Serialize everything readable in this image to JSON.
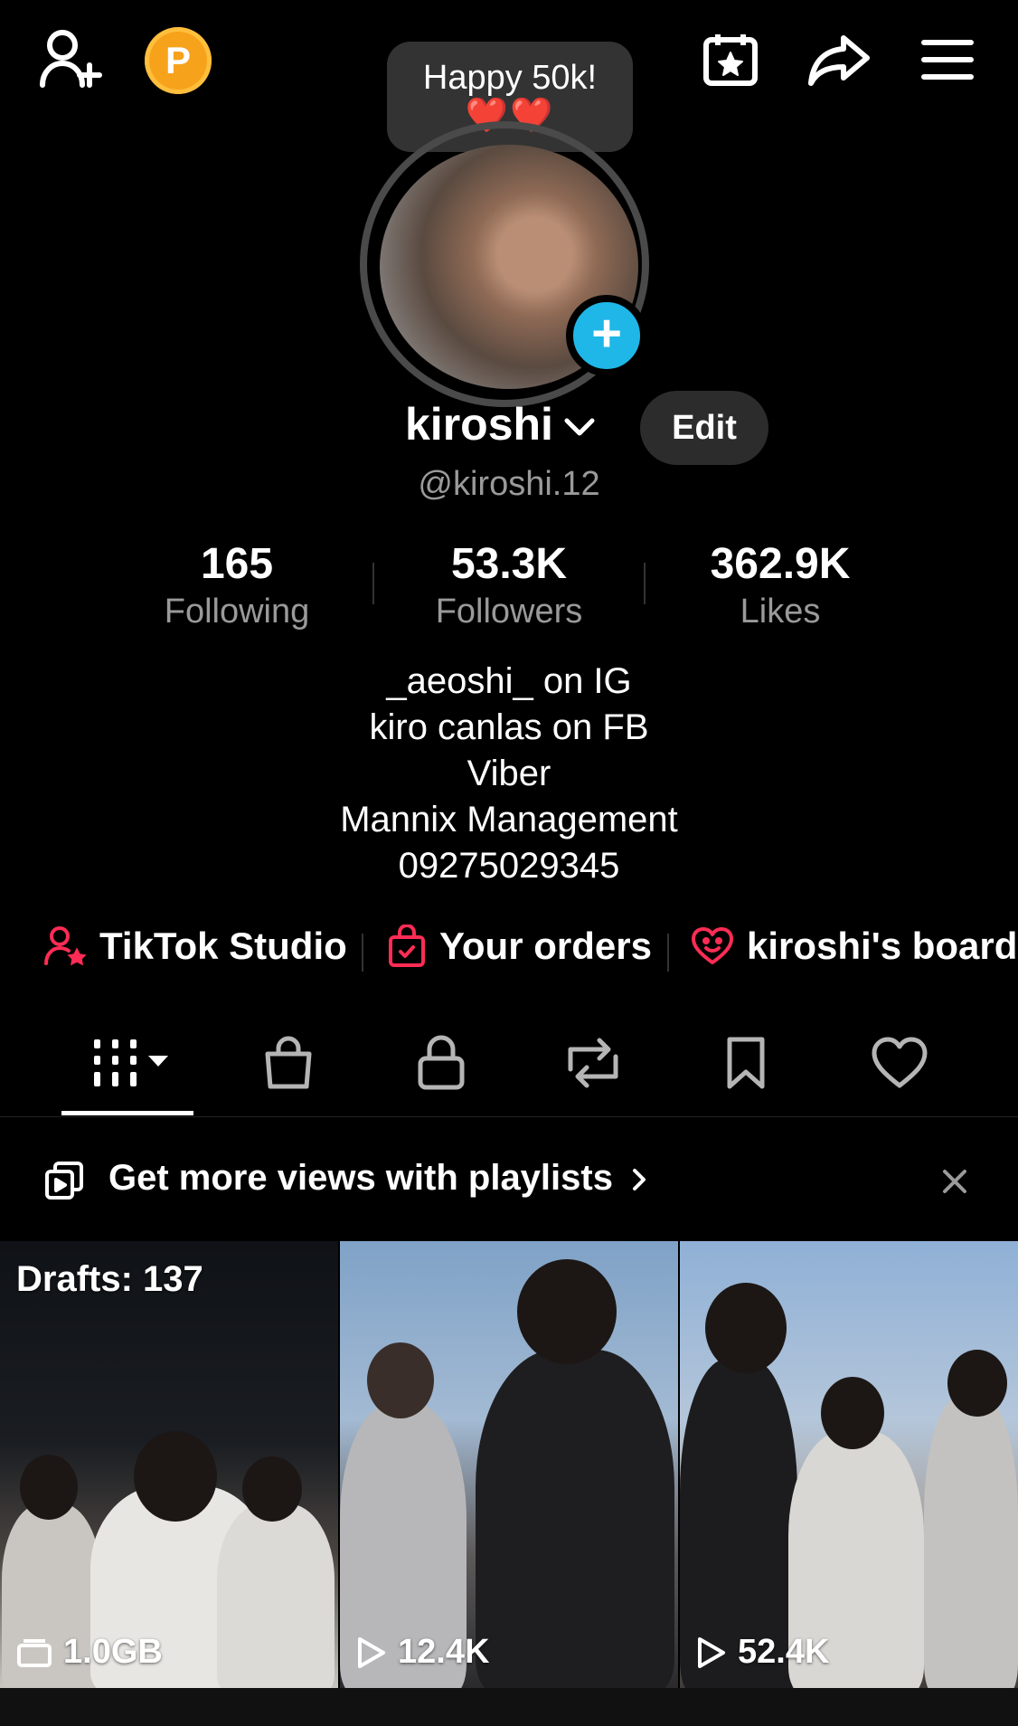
{
  "topbar": {
    "coin_letter": "P",
    "bubble_text": "Happy 50k!",
    "bubble_hearts": "❤️❤️"
  },
  "profile": {
    "display_name": "kiroshi",
    "edit_label": "Edit",
    "handle": "@kiroshi.12"
  },
  "stats": [
    {
      "value": "165",
      "label": "Following"
    },
    {
      "value": "53.3K",
      "label": "Followers"
    },
    {
      "value": "362.9K",
      "label": "Likes"
    }
  ],
  "bio": [
    "_aeoshi_ on IG",
    "kiro canlas on FB",
    "Viber",
    "Mannix Management",
    "09275029345"
  ],
  "links": [
    {
      "label": "TikTok Studio",
      "icon": "studio-icon"
    },
    {
      "label": "Your orders",
      "icon": "orders-bag-icon"
    },
    {
      "label": "kiroshi's board",
      "icon": "board-icon"
    }
  ],
  "tabs": [
    {
      "name": "videos-grid-icon",
      "active": true
    },
    {
      "name": "shop-bag-icon",
      "active": false
    },
    {
      "name": "lock-icon",
      "active": false
    },
    {
      "name": "repost-icon",
      "active": false
    },
    {
      "name": "bookmark-icon",
      "active": false
    },
    {
      "name": "heart-icon",
      "active": false
    }
  ],
  "banner": {
    "text": "Get more views with playlists"
  },
  "grid": [
    {
      "top_label": "Drafts: 137",
      "count": "1.0GB",
      "count_icon": "folder-icon"
    },
    {
      "top_label": "",
      "count": "12.4K",
      "count_icon": "play-icon"
    },
    {
      "top_label": "",
      "count": "52.4K",
      "count_icon": "play-icon"
    }
  ],
  "colors": {
    "background": "#000000",
    "accent_blue": "#1fb7e7",
    "coin_orange": "#f7a21b",
    "link_red": "#fe2c55",
    "muted_text": "#9a9a9a"
  }
}
